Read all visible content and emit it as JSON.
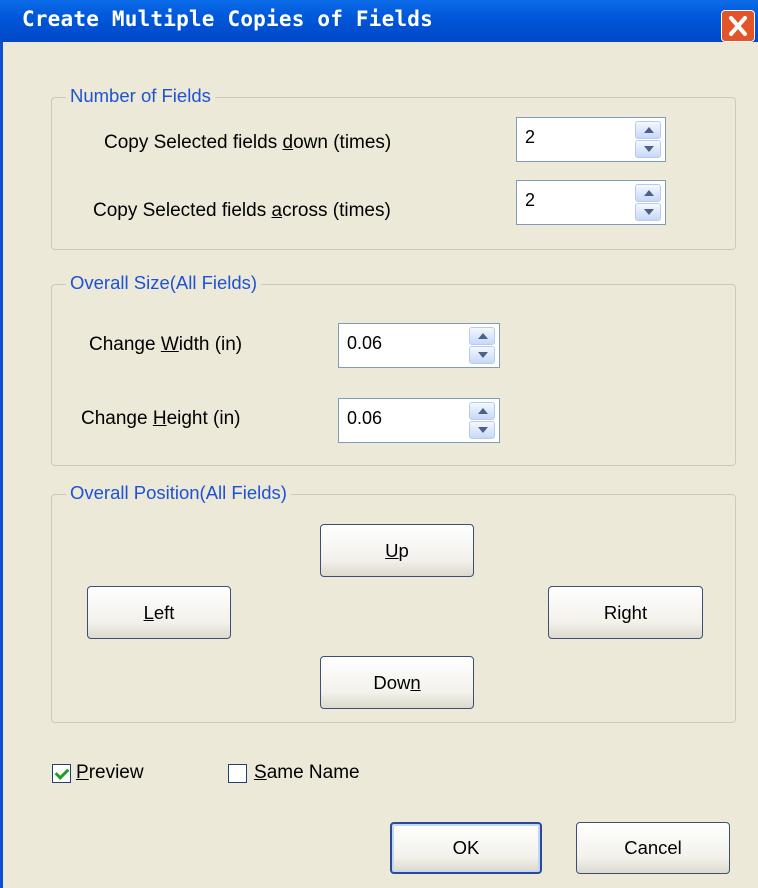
{
  "window": {
    "title": "Create Multiple Copies of Fields"
  },
  "groups": {
    "number_of_fields": {
      "legend": "Number of Fields",
      "down_label_pre": "Copy Selected fields ",
      "down_label_key": "d",
      "down_label_post": "own (times)",
      "down_value": "2",
      "across_label_pre": "Copy Selected fields ",
      "across_label_key": "a",
      "across_label_post": "cross (times)",
      "across_value": "2"
    },
    "overall_size": {
      "legend": "Overall Size(All Fields)",
      "width_label_pre": "Change ",
      "width_label_key": "W",
      "width_label_post": "idth (in)",
      "width_value": "0.06",
      "height_label_pre": "Change ",
      "height_label_key": "H",
      "height_label_post": "eight (in)",
      "height_value": "0.06"
    },
    "overall_position": {
      "legend": "Overall Position(All Fields)",
      "up_key": "U",
      "up_rest": "p",
      "left_key": "L",
      "left_rest": "eft",
      "right_pre": "Ri",
      "right_key": "g",
      "right_rest": "ht",
      "down_pre": "Dow",
      "down_key": "n"
    }
  },
  "options": {
    "preview_key": "P",
    "preview_rest": "review",
    "preview_checked": true,
    "same_name_key": "S",
    "same_name_rest": "ame Name",
    "same_name_checked": false
  },
  "footer": {
    "ok_label": "OK",
    "cancel_label": "Cancel"
  },
  "icons": {
    "close": "close-icon",
    "spin_up": "chevron-up-icon",
    "spin_down": "chevron-down-icon",
    "check": "checkmark-icon"
  },
  "colors": {
    "title_bar": "#0056d8",
    "close_button": "#e2542a",
    "legend_text": "#1e52d4",
    "dialog_bg": "#ece9d8",
    "check_mark": "#21a121"
  }
}
